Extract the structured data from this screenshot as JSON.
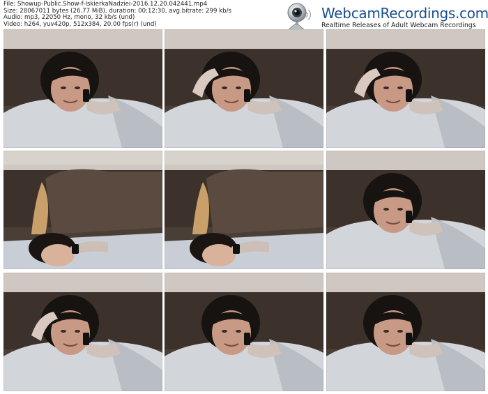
{
  "file_info": {
    "file": "File: Showup-Public.Show-f-IskierkaNadziei-2016.12.20.042441.mp4",
    "size": "Size: 28067011 bytes (26.77 MiB), duration: 00:12:30, avg.bitrate: 299 kb/s",
    "audio": "Audio: mp3, 22050 Hz, mono, 32 kb/s (und)",
    "video": "Video: h264, yuv420p, 512x384, 20.00 fps(r) (und)"
  },
  "logo": {
    "brand": "WebcamRecordings.com",
    "tagline": "Realtime Releases of Adult Webcam Recordings",
    "icon": "webcam-icon",
    "brand_color": "#1a4f8f"
  },
  "thumbnails": [
    {
      "id": 1,
      "scene": "smiling-phone"
    },
    {
      "id": 2,
      "scene": "hand-on-head-phone"
    },
    {
      "id": 3,
      "scene": "smirk-phone"
    },
    {
      "id": 4,
      "scene": "lying-low-phone"
    },
    {
      "id": 5,
      "scene": "lying-low-phone"
    },
    {
      "id": 6,
      "scene": "lean-phone"
    },
    {
      "id": 7,
      "scene": "hand-on-head-phone"
    },
    {
      "id": 8,
      "scene": "smiling-phone"
    },
    {
      "id": 9,
      "scene": "lean-phone"
    }
  ]
}
